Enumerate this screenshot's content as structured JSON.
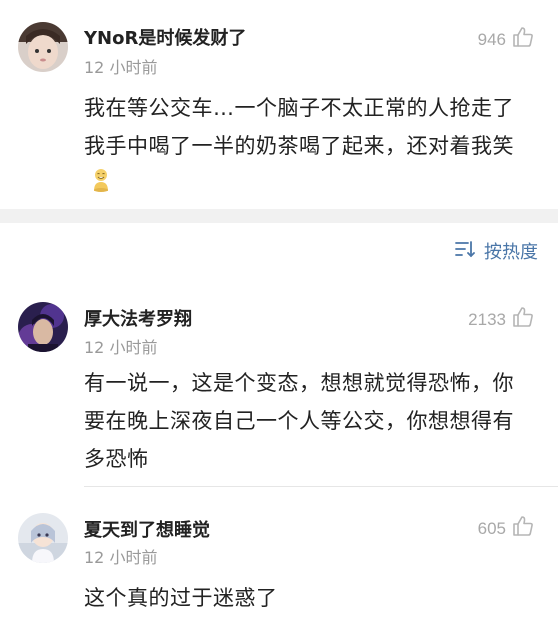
{
  "comments": [
    {
      "username": "YNoR是时候发财了",
      "time": "12 小时前",
      "likes": "946",
      "text": "我在等公交车…一个脑子不太正常的人抢走了我手中喝了一半的奶茶喝了起来，还对着我笑",
      "emoji_icon": "laughing-figure-icon"
    },
    {
      "username": "厚大法考罗翔",
      "time": "12 小时前",
      "likes": "2133",
      "text": "有一说一，这是个变态，想想就觉得恐怖，你要在晚上深夜自己一个人等公交，你想想得有多恐怖"
    },
    {
      "username": "夏天到了想睡觉",
      "time": "12 小时前",
      "likes": "605",
      "text": "这个真的过于迷惑了"
    }
  ],
  "sort": {
    "label": "按热度",
    "icon": "sort-icon"
  },
  "colors": {
    "accent": "#4a76a8",
    "muted": "#9a9a9a",
    "band": "#f1f1f1"
  }
}
